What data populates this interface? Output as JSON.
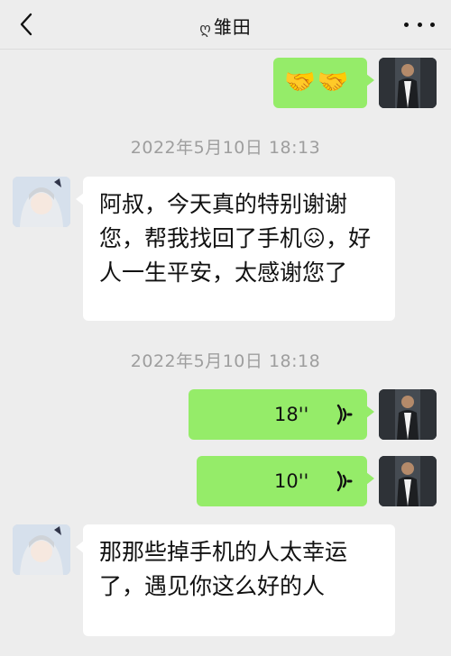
{
  "header": {
    "title_prefix": "ღ",
    "title": "雏田"
  },
  "messages": {
    "m1": {
      "from": "me",
      "type": "emoji",
      "content": "🤝🤝"
    },
    "ts1": "2022年5月10日 18:13",
    "m2": {
      "from": "contact",
      "type": "text",
      "text": "阿叔，今天真的特别谢谢您，帮我找回了手机😖，好人一生平安，太感谢您了"
    },
    "ts2": "2022年5月10日 18:18",
    "m3": {
      "from": "me",
      "type": "voice",
      "duration": "18''"
    },
    "m4": {
      "from": "me",
      "type": "voice",
      "duration": "10''"
    },
    "m5": {
      "from": "contact",
      "type": "text",
      "text": "那那些掉手机的人太幸运了，遇见你这么好的人"
    }
  },
  "colors": {
    "sent_bubble": "#95ec69",
    "received_bubble": "#ffffff",
    "background": "#ededed",
    "timestamp": "#9e9e9e"
  },
  "icons": [
    "back-arrow-icon",
    "more-icon",
    "voice-wave-icon",
    "sent-avatar",
    "contact-avatar"
  ]
}
